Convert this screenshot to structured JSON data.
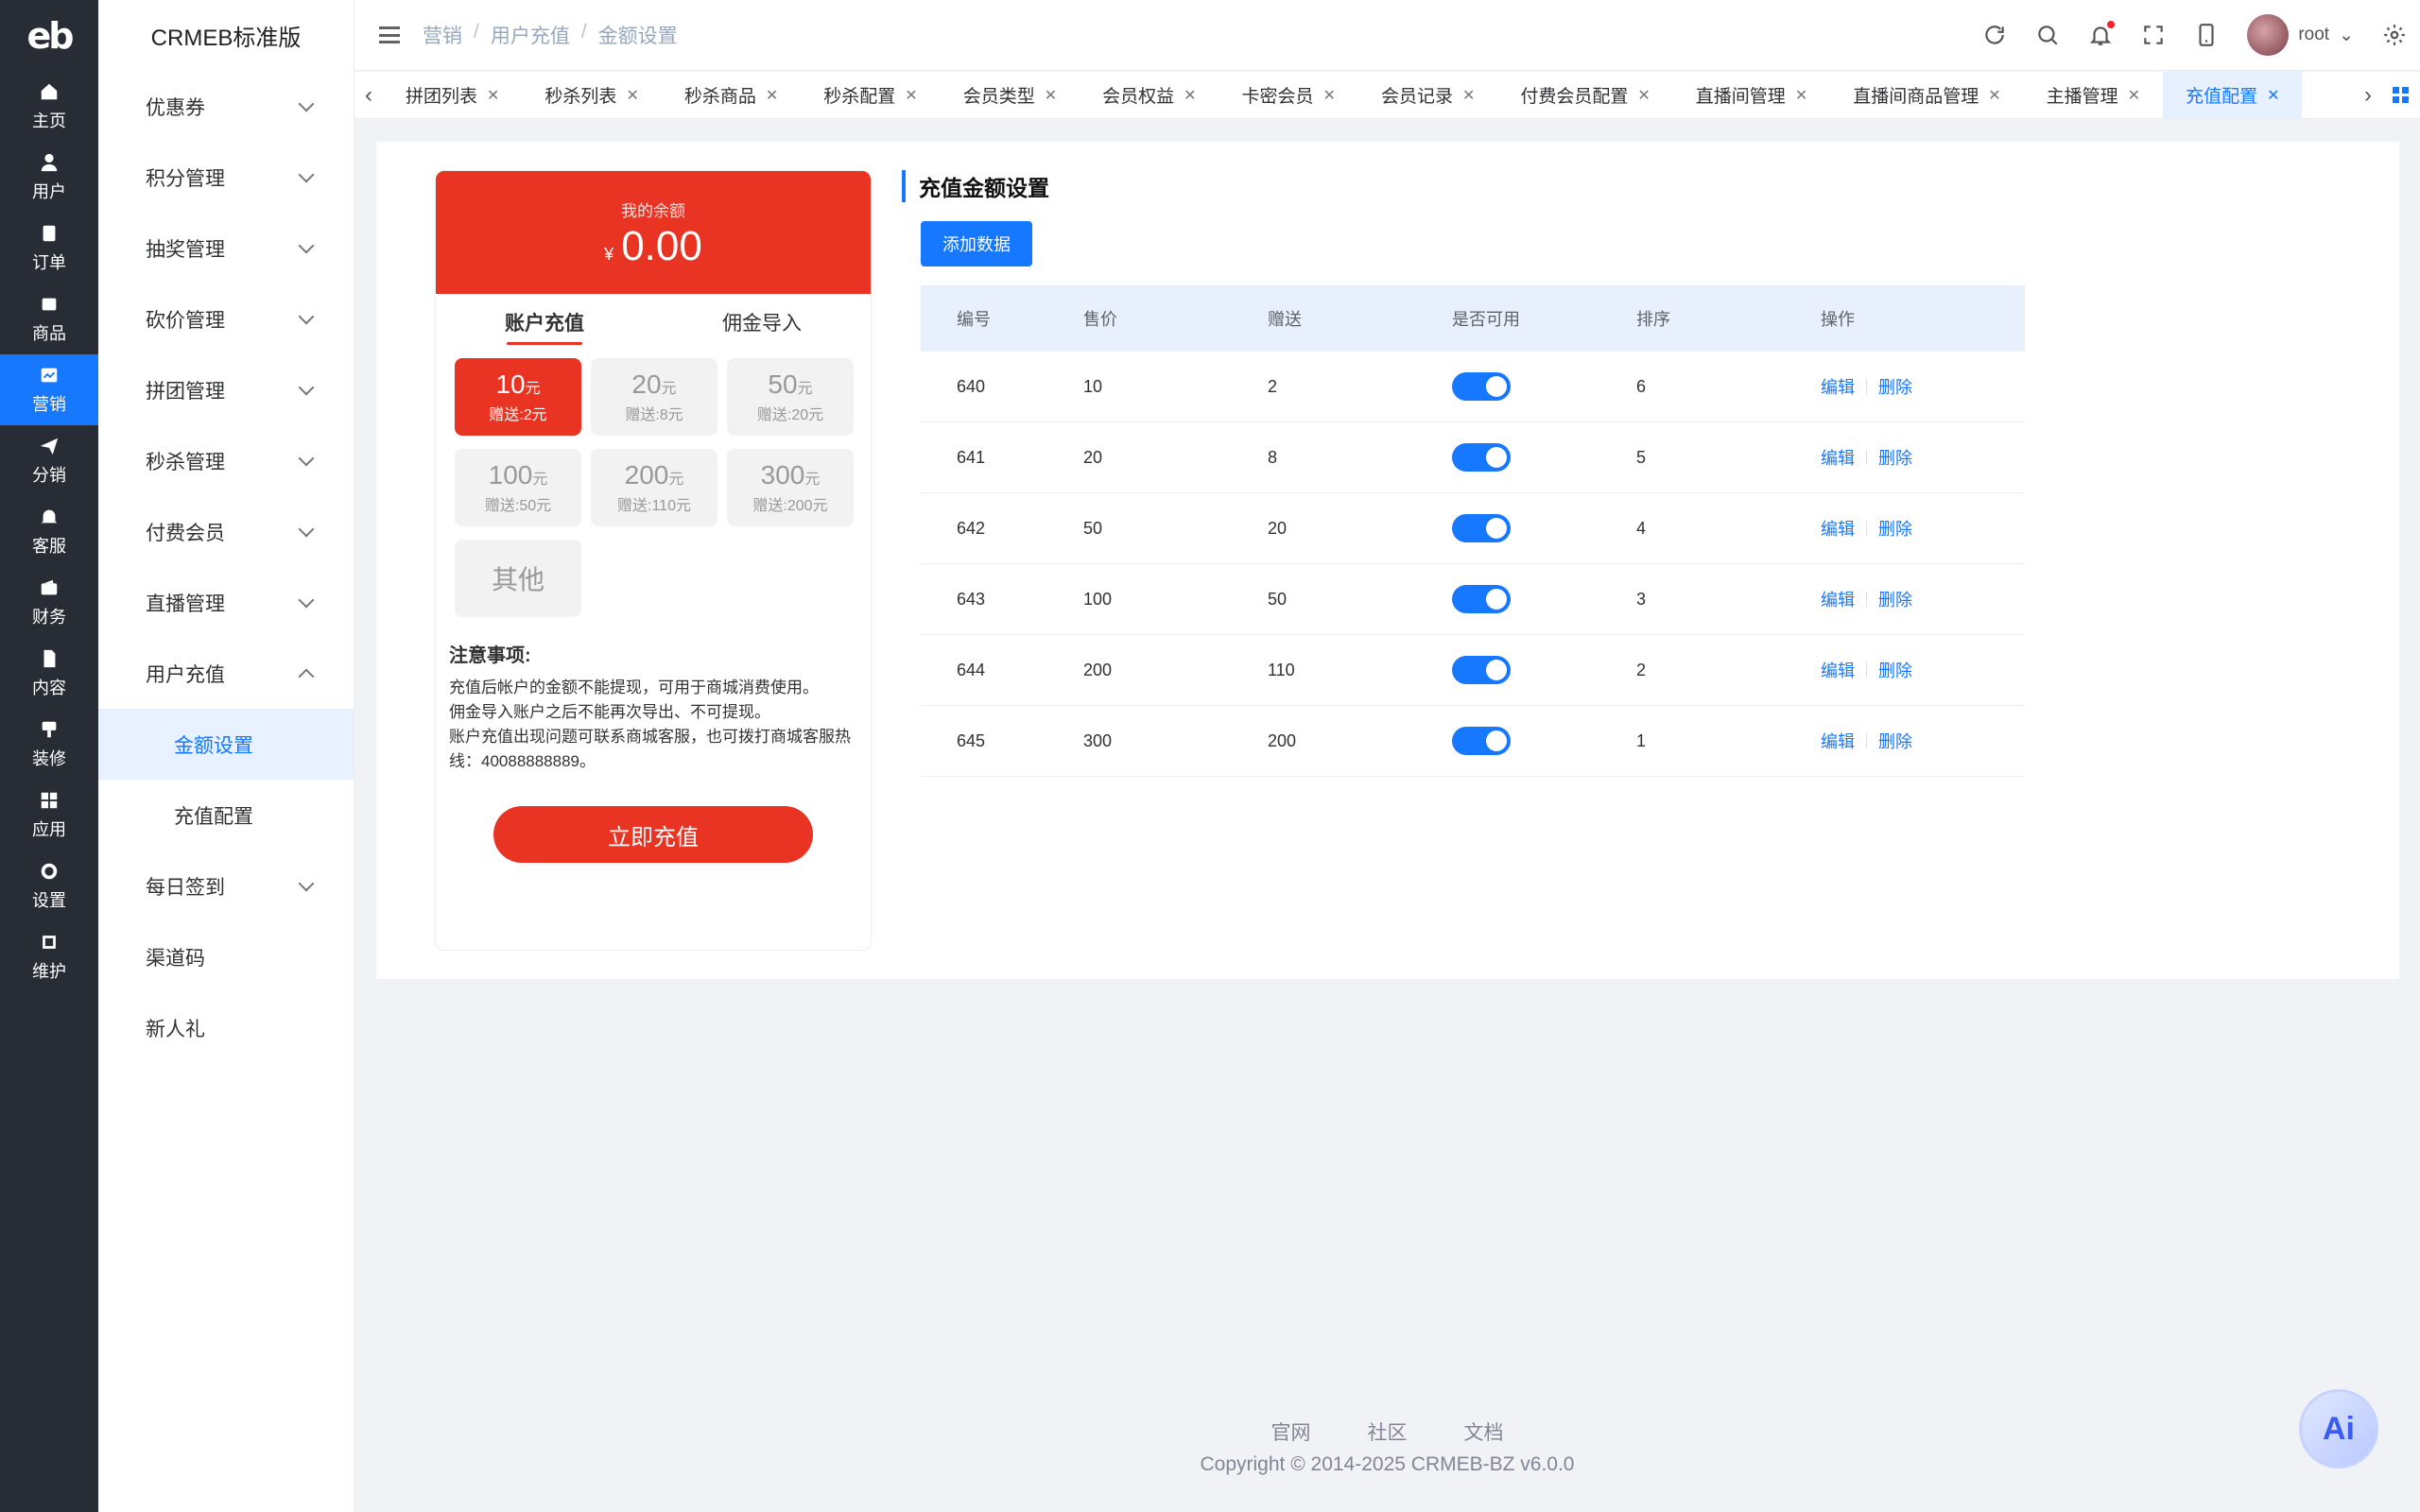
{
  "app": {
    "logo_text": "eb",
    "title": "CRMEB标准版"
  },
  "rail": [
    {
      "label": "主页",
      "icon": "home-icon"
    },
    {
      "label": "用户",
      "icon": "user-icon"
    },
    {
      "label": "订单",
      "icon": "order-icon"
    },
    {
      "label": "商品",
      "icon": "product-icon"
    },
    {
      "label": "营销",
      "icon": "marketing-icon",
      "active": true
    },
    {
      "label": "分销",
      "icon": "send-icon"
    },
    {
      "label": "客服",
      "icon": "bell-icon"
    },
    {
      "label": "财务",
      "icon": "wallet-icon"
    },
    {
      "label": "内容",
      "icon": "document-icon"
    },
    {
      "label": "装修",
      "icon": "brush-icon"
    },
    {
      "label": "应用",
      "icon": "apps-icon"
    },
    {
      "label": "设置",
      "icon": "gear-icon"
    },
    {
      "label": "维护",
      "icon": "chip-icon"
    }
  ],
  "submenu": {
    "coupon": "优惠券",
    "points": "积分管理",
    "lottery": "抽奖管理",
    "bargain": "砍价管理",
    "group": "拼团管理",
    "seckill": "秒杀管理",
    "paid_member": "付费会员",
    "live": "直播管理",
    "recharge": "用户充值",
    "recharge_amount": "金额设置",
    "recharge_config": "充值配置",
    "signin": "每日签到",
    "channel": "渠道码",
    "newcomer": "新人礼"
  },
  "breadcrumb": {
    "l1": "营销",
    "l2": "用户充值",
    "l3": "金额设置",
    "sep": "/"
  },
  "header": {
    "username": "root"
  },
  "tabs": [
    {
      "label": "拼团列表"
    },
    {
      "label": "秒杀列表"
    },
    {
      "label": "秒杀商品"
    },
    {
      "label": "秒杀配置"
    },
    {
      "label": "会员类型"
    },
    {
      "label": "会员权益"
    },
    {
      "label": "卡密会员"
    },
    {
      "label": "会员记录"
    },
    {
      "label": "付费会员配置"
    },
    {
      "label": "直播间管理"
    },
    {
      "label": "直播间商品管理"
    },
    {
      "label": "主播管理"
    },
    {
      "label": "充值配置",
      "active": true
    }
  ],
  "preview": {
    "balance_label": "我的余额",
    "currency": "¥",
    "balance": "0.00",
    "tab_recharge": "账户充值",
    "tab_import": "佣金导入",
    "packages": [
      {
        "value": "10",
        "unit": "元",
        "gift": "赠送:2元",
        "active": true
      },
      {
        "value": "20",
        "unit": "元",
        "gift": "赠送:8元"
      },
      {
        "value": "50",
        "unit": "元",
        "gift": "赠送:20元"
      },
      {
        "value": "100",
        "unit": "元",
        "gift": "赠送:50元"
      },
      {
        "value": "200",
        "unit": "元",
        "gift": "赠送:110元"
      },
      {
        "value": "300",
        "unit": "元",
        "gift": "赠送:200元"
      }
    ],
    "other": "其他",
    "notice_title": "注意事项:",
    "notice_1": "充值后帐户的金额不能提现，可用于商城消费使用。",
    "notice_2": "佣金导入账户之后不能再次导出、不可提现。",
    "notice_3": "账户充值出现问题可联系商城客服，也可拨打商城客服热线：40088888889。",
    "pay_button": "立即充值"
  },
  "section": {
    "title": "充值金额设置",
    "add_button": "添加数据"
  },
  "table": {
    "headers": {
      "id": "编号",
      "price": "售价",
      "gift": "赠送",
      "enabled": "是否可用",
      "sort": "排序",
      "ops": "操作"
    },
    "edit": "编辑",
    "delete": "删除",
    "rows": [
      {
        "id": "640",
        "price": "10",
        "gift": "2",
        "enabled": true,
        "sort": "6"
      },
      {
        "id": "641",
        "price": "20",
        "gift": "8",
        "enabled": true,
        "sort": "5"
      },
      {
        "id": "642",
        "price": "50",
        "gift": "20",
        "enabled": true,
        "sort": "4"
      },
      {
        "id": "643",
        "price": "100",
        "gift": "50",
        "enabled": true,
        "sort": "3"
      },
      {
        "id": "644",
        "price": "200",
        "gift": "110",
        "enabled": true,
        "sort": "2"
      },
      {
        "id": "645",
        "price": "300",
        "gift": "200",
        "enabled": true,
        "sort": "1"
      }
    ]
  },
  "footer": {
    "link_official": "官网",
    "link_community": "社区",
    "link_docs": "文档",
    "copyright": "Copyright © 2014-2025 CRMEB-BZ v6.0.0"
  },
  "ai_button": "Ai",
  "colors": {
    "primary": "#1677ff",
    "brand_red": "#e93323",
    "rail_bg": "#282c34"
  }
}
